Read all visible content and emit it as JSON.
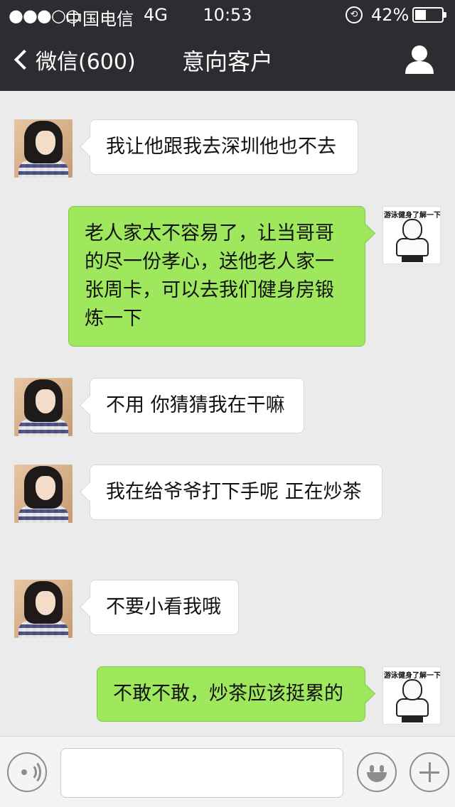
{
  "status_bar": {
    "signal": "●●●○○",
    "carrier": "中国电信",
    "network": "4G",
    "time": "10:53",
    "battery_percent": "42%",
    "battery_level": 0.42
  },
  "nav": {
    "back_label": "微信(600)",
    "title": "意向客户",
    "back_icon": "chevron-left-icon",
    "profile_icon": "person-icon"
  },
  "me_avatar_caption": "游泳健身了解一下",
  "messages": [
    {
      "from": "customer",
      "text": "我让他跟我去深圳他也不去"
    },
    {
      "from": "me",
      "text": "老人家太不容易了，让当哥哥的尽一份孝心，送他老人家一张周卡，可以去我们健身房锻炼一下"
    },
    {
      "from": "customer",
      "text": "不用 你猜猜我在干嘛"
    },
    {
      "from": "customer",
      "text": "我在给爷爷打下手呢 正在炒茶"
    },
    {
      "from": "customer",
      "text": "不要小看我哦"
    },
    {
      "from": "me",
      "text": "不敢不敢，炒茶应该挺累的"
    }
  ],
  "input_bar": {
    "message_value": "",
    "voice_icon": "voice-icon",
    "emoji_icon": "emoji-icon",
    "more_icon": "plus-icon"
  },
  "colors": {
    "header_bg": "#2b2d30",
    "chat_bg": "#ebebeb",
    "my_bubble": "#9fe85d",
    "their_bubble": "#ffffff"
  }
}
